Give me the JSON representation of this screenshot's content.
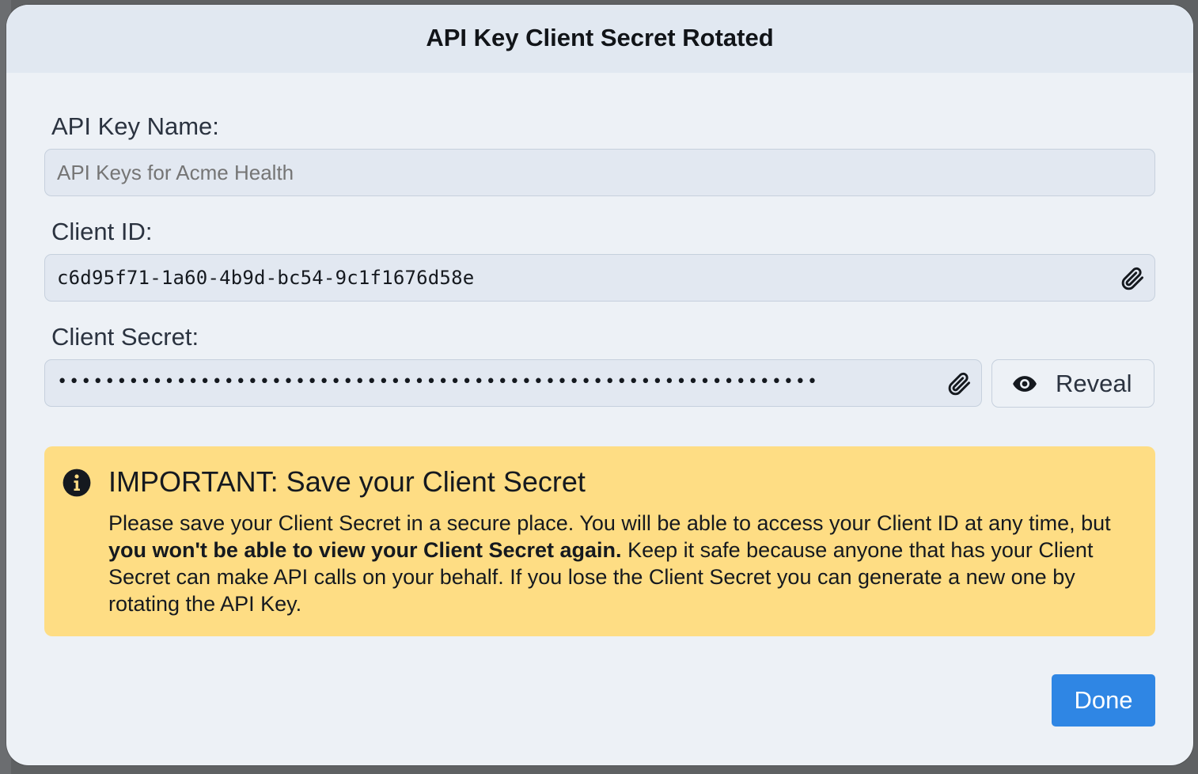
{
  "dialog": {
    "title": "API Key Client Secret Rotated"
  },
  "fields": {
    "api_key_name": {
      "label": "API Key Name:",
      "placeholder": "API Keys for Acme Health",
      "value": ""
    },
    "client_id": {
      "label": "Client ID:",
      "value": "c6d95f71-1a60-4b9d-bc54-9c1f1676d58e",
      "copy_icon": "paperclip-icon"
    },
    "client_secret": {
      "label": "Client Secret:",
      "masked_value": "••••••••••••••••••••••••••••••••••••••••••••••••••••••••••••••••",
      "copy_icon": "paperclip-icon",
      "reveal_label": "Reveal",
      "reveal_icon": "eye-icon"
    }
  },
  "alert": {
    "icon": "info-icon",
    "title": "IMPORTANT: Save your Client Secret",
    "body_part1": "Please save your Client Secret in a secure place. You will be able to access your Client ID at any time, but ",
    "body_bold": "you won't be able to view your Client Secret again.",
    "body_part2": " Keep it safe because anyone that has your Client Secret can make API calls on your behalf. If you lose the Client Secret you can generate a new one by rotating the API Key.",
    "background_color": "#fedd84"
  },
  "footer": {
    "done_label": "Done",
    "done_color": "#2f86e4"
  }
}
